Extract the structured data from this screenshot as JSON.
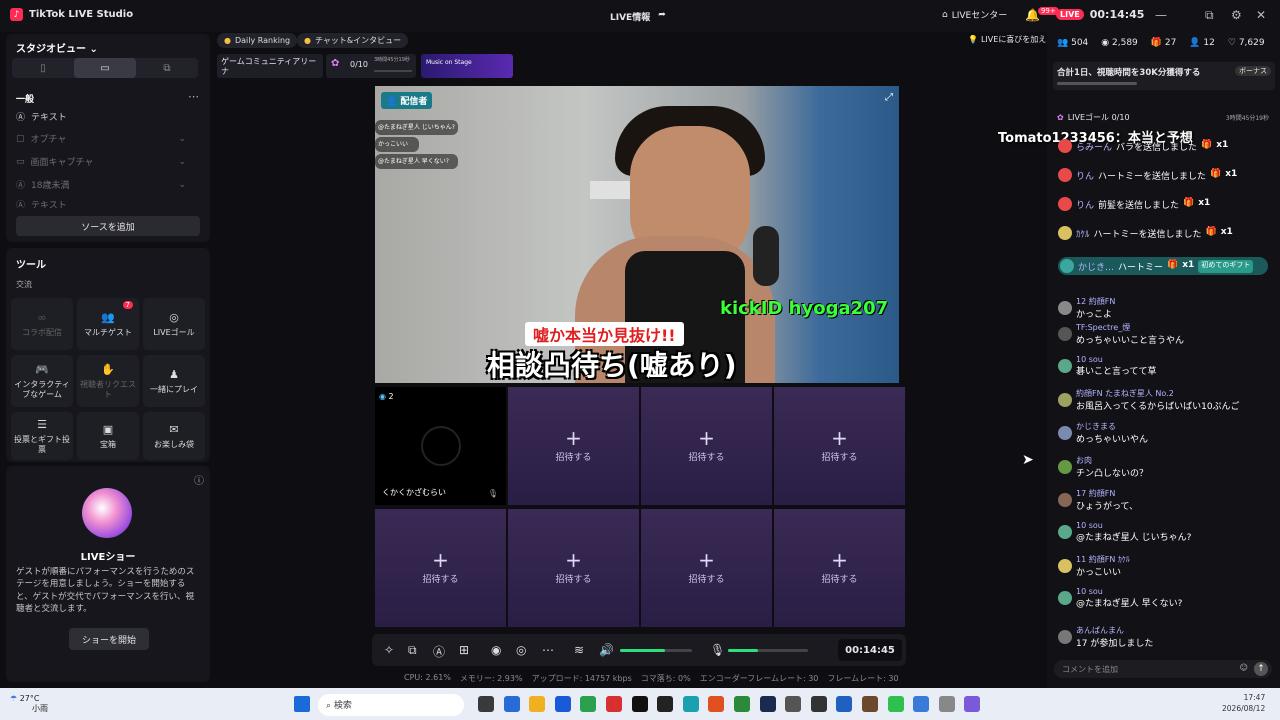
{
  "app": {
    "title": "TikTok LIVE Studio",
    "center_title": "LIVE情報",
    "live_center": "LIVEセンター",
    "notif_badge": "99+",
    "live_label": "LIVE",
    "timer": "00:14:45"
  },
  "left": {
    "studio_view": "スタジオビュー",
    "general": "一般",
    "sources": [
      "テキスト",
      "オプチャ",
      "画面キャプチャ",
      "18歳未満",
      "テキスト"
    ],
    "add_source": "ソースを追加",
    "tools_title": "ツール",
    "tools_sub": "交流",
    "tools": [
      {
        "label": "コラボ配信",
        "icon": "∞"
      },
      {
        "label": "マルチゲスト",
        "icon": "👥",
        "badge": "7"
      },
      {
        "label": "LIVEゴール",
        "icon": "◎"
      },
      {
        "label": "インタラクティブなゲーム",
        "icon": "🎮"
      },
      {
        "label": "視聴者リクエスト",
        "icon": "✋"
      },
      {
        "label": "一緒にプレイ",
        "icon": "♟"
      },
      {
        "label": "投票とギフト投票",
        "icon": "☰"
      },
      {
        "label": "宝箱",
        "icon": "▣"
      },
      {
        "label": "お楽しみ袋",
        "icon": "✉"
      }
    ],
    "show_title": "LIVEショー",
    "show_desc": "ゲストが順番にパフォーマンスを行うためのステージを用意しましょう。ショーを開始すると、ゲストが交代でパフォーマンスを行い、視聴者と交流します。",
    "show_button": "ショーを開始"
  },
  "top_pills": {
    "ranking": "Daily Ranking",
    "chat_interview": "チャット&インタビュー",
    "game_arena": "ゲームコミュニティアリーナ",
    "goal_count": "0/10",
    "goal_timer": "3時間45分19秒",
    "music_banner": "Music on Stage"
  },
  "video": {
    "host_label": "配信者",
    "overlay_chat": [
      "@たまねぎ星人 じいちゃん?",
      "かっこいい",
      "@たまねぎ星人 早くない?"
    ],
    "kick_id": "kickID hyoga207",
    "caption1": "嘘か本当か見抜け!!",
    "caption2": "相談凸待ち(嘘あり)"
  },
  "guests": {
    "guest_name": "くかくかざむらい",
    "guest_count": "2",
    "invite": "招待する"
  },
  "stats": {
    "cpu": "CPU: 2.61%",
    "memory": "メモリー: 2.93%",
    "upload": "アップロード: 14757 kbps",
    "dropped": "コマ落ち: 0%",
    "encoder": "エンコーダーフレームレート: 30",
    "framerate": "フレームレート: 30"
  },
  "right": {
    "live_hint": "LIVEに喜びを加え",
    "viewers": "504",
    "views": "2,589",
    "gifts": "27",
    "guests": "12",
    "likes": "7,629",
    "goal_banner": "合計1日、視聴時間を30K分獲得する",
    "bonus": "ボーナス",
    "goal_row": "LIVEゴール 0/10",
    "goal_timer": "3時間45分19秒",
    "overlay_text": "Tomato1233456：本当と予想",
    "comment_placeholder": "コメントを追加",
    "chat": [
      {
        "user": "らみーん",
        "text": "バラを送信しました",
        "x": "x1",
        "color": "#e84a4a"
      },
      {
        "user": "りん",
        "text": "ハートミーを送信しました",
        "x": "x1",
        "color": "#e84a4a"
      },
      {
        "user": "りん",
        "text": "前髪を送信しました",
        "x": "x1",
        "color": "#e84a4a"
      },
      {
        "user": "ｶｹﾙ",
        "text": "ハートミーを送信しました",
        "x": "x1",
        "color": "#d9c060"
      },
      {
        "user": "かじき…",
        "text": "ハートミー",
        "x": "x1",
        "color": "#3aa8a0",
        "tag": "初めてのギフト"
      },
      {
        "user": "12 約顔FN",
        "text": "かっこよ",
        "color": "#888"
      },
      {
        "user": "TF:Spectre_煙",
        "text": "めっちゃいいこと言うやん",
        "color": "#555"
      },
      {
        "user": "10 sou",
        "text": "碁いこと言ってて草",
        "color": "#5aa88a"
      },
      {
        "user": "約顔FN たまねぎ星人 No.2",
        "text": "お風呂入ってくるからばいばい10ぷんご",
        "color": "#a0a060"
      },
      {
        "user": "かじきまる",
        "text": "めっちゃいいやん",
        "color": "#7a8ab0"
      },
      {
        "user": "お肉",
        "text": "チン凸しないの？",
        "color": "#669944"
      },
      {
        "user": "17 約顔FN",
        "text": "ひょうがって、",
        "color": "#886655"
      },
      {
        "user": "10 sou",
        "text": "@たまねぎ星人 じいちゃん?",
        "color": "#5aa88a"
      },
      {
        "user": "11 約顔FN ｶｹﾙ",
        "text": "かっこいい",
        "color": "#d9c060"
      },
      {
        "user": "10 sou",
        "text": "@たまねぎ星人 早くない?",
        "color": "#5aa88a"
      },
      {
        "user": "あんぱんまん",
        "text": "17 が参加しました",
        "color": "#777"
      }
    ]
  },
  "taskbar": {
    "weather_temp": "27°C",
    "weather_desc": "小雨",
    "search": "検索",
    "time": "17:47",
    "date": "2026/08/12"
  }
}
